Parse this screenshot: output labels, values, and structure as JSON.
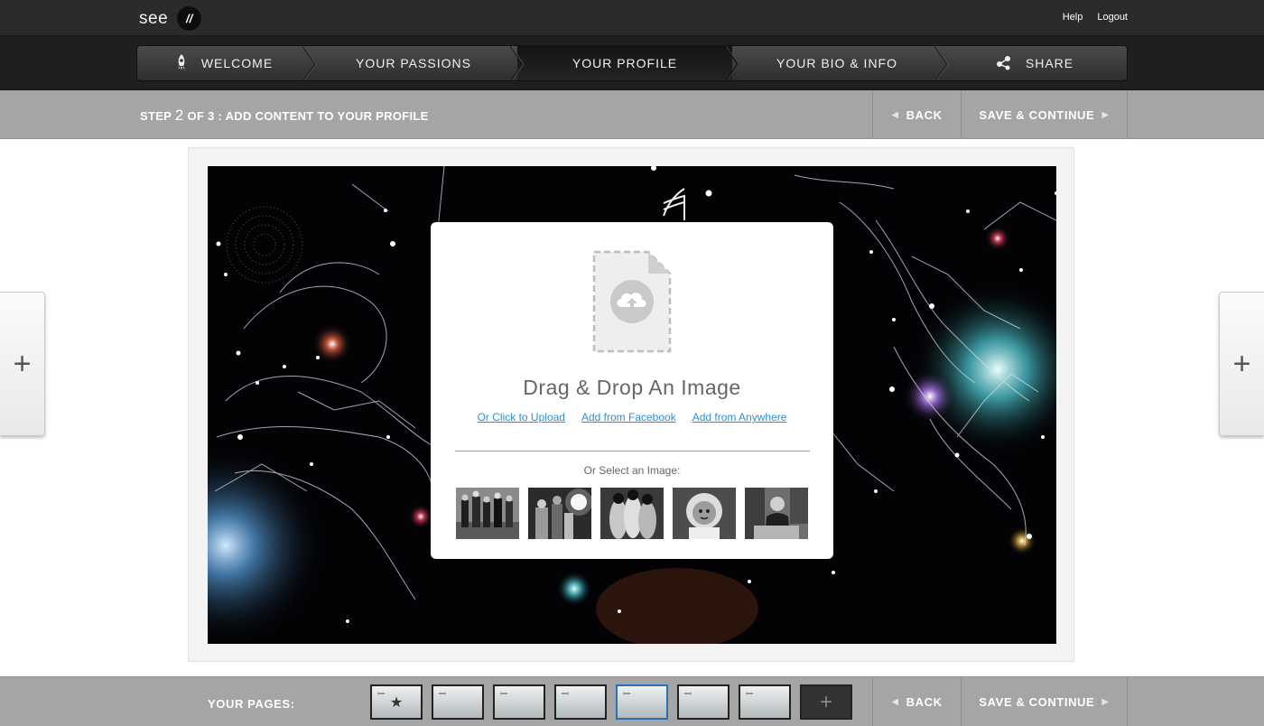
{
  "topbar": {
    "logo_text": "see",
    "logo_badge": "//",
    "links": [
      "Help",
      "Logout"
    ]
  },
  "steps": [
    {
      "label": "Welcome",
      "icon": "rocket-icon",
      "active": false
    },
    {
      "label": "Your Passions",
      "icon": "",
      "active": false
    },
    {
      "label": "Your Profile",
      "icon": "",
      "active": true
    },
    {
      "label": "Your Bio & Info",
      "icon": "",
      "active": false
    },
    {
      "label": "Share",
      "icon": "share-icon",
      "active": false
    }
  ],
  "stepbar": {
    "prefix": "STEP",
    "current": "2",
    "suffix": "OF 3 : ADD CONTENT TO YOUR PROFILE",
    "back_label": "BACK",
    "continue_label": "SAVE & CONTINUE"
  },
  "side_buttons": {
    "left": "+",
    "right": "+"
  },
  "upload": {
    "title": "Drag & Drop An Image",
    "link_upload": "Or Click to Upload",
    "link_facebook": "Add from Facebook",
    "link_anywhere": "Add from Anywhere",
    "select_label": "Or Select an Image:",
    "thumbnails": [
      "stock-photo-1",
      "stock-photo-2",
      "stock-photo-3",
      "stock-photo-4",
      "stock-photo-5"
    ]
  },
  "bottombar": {
    "pages_label": "YOUR PAGES:",
    "page_count": 7,
    "active_page": 5,
    "add_label": "+",
    "back_label": "BACK",
    "continue_label": "SAVE & CONTINUE"
  },
  "colors": {
    "topbar": "#2b2b2b",
    "stepbar": "#a5a5a5",
    "link": "#2b8fd6",
    "active_page_border": "#2a6fb8"
  }
}
